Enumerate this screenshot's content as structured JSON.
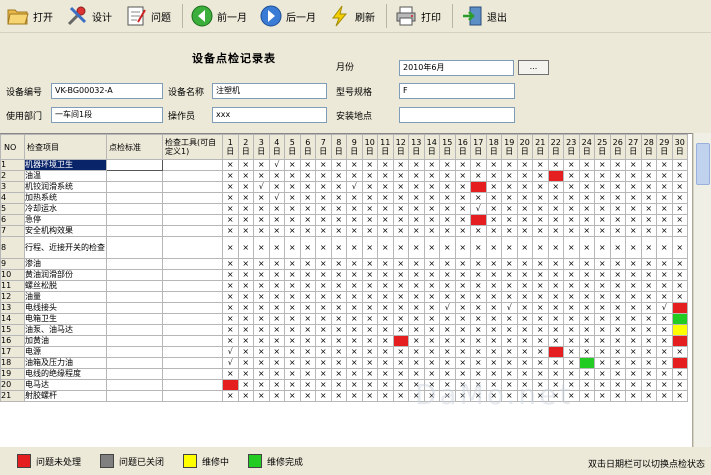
{
  "toolbar": {
    "open": "打开",
    "design": "设计",
    "issue": "问题",
    "prev": "前一月",
    "next": "后一月",
    "refresh": "刷新",
    "print": "打印",
    "exit": "退出"
  },
  "form": {
    "title": "设备点检记录表",
    "month_label": "月份",
    "month_value": "2010年6月",
    "month_button": "...",
    "device_no_label": "设备编号",
    "device_no_value": "VK-BG00032-A",
    "device_name_label": "设备名称",
    "device_name_value": "注塑机",
    "model_label": "型号规格",
    "model_value": "F",
    "dept_label": "使用部门",
    "dept_value": "一车间1段",
    "operator_label": "操作员",
    "operator_value": "xxx",
    "location_label": "安装地点",
    "location_value": ""
  },
  "grid": {
    "col_no": "NO",
    "col_item": "检查项目",
    "col_standard": "点检标准",
    "col_tool": "检查工具(可自定义1)",
    "days": [
      "1",
      "2",
      "3",
      "4",
      "5",
      "6",
      "7",
      "8",
      "9",
      "10",
      "11",
      "12",
      "13",
      "14",
      "15",
      "16",
      "17",
      "18",
      "19",
      "20",
      "21",
      "22",
      "23",
      "24",
      "25",
      "26",
      "27",
      "28",
      "29",
      "30"
    ],
    "day_suffix": "日",
    "rows": [
      {
        "no": "1",
        "item": "机器环境卫生",
        "marks": "X X X ✓ X X X X X X X X X X X X X X X X X X X X X X X X X X"
      },
      {
        "no": "2",
        "item": "油温",
        "marks": "X X X X X X X X X X X X X X X X X X X X X R X X X X X X X X"
      },
      {
        "no": "3",
        "item": "机铰润滑系统",
        "marks": "X X ✓ X X X X X ✓ X X X X X X X R X X X X X X X X X X X X X"
      },
      {
        "no": "4",
        "item": "加热系统",
        "marks": "X X X ✓ X X X X X X X X X X X X X X X X X X X X X X X X X X"
      },
      {
        "no": "5",
        "item": "冷却运水",
        "marks": "X X X X X X X X X X X X X X X X ✓ X X X X X X X X X X X X X"
      },
      {
        "no": "6",
        "item": "急停",
        "marks": "X X X X X X X X X X X X X X X X R X X X X X X X X X X X X X"
      },
      {
        "no": "7",
        "item": "安全机构效果",
        "marks": "X X X X X X X X X X X X X X X X X X X X X X X X X X X X X X"
      },
      {
        "no": "8",
        "item": "行程、近接开关的检查",
        "marks": "X X X X X X X X X X X X X X X X X X X X X X X X X X X X X X",
        "tall": true
      },
      {
        "no": "9",
        "item": "渗油",
        "marks": "X X X X X X X X X X X X X X X X X X X X X X X X X X X X X X"
      },
      {
        "no": "10",
        "item": "黄油润滑部份",
        "marks": "X X X X X X X X X X X X X X X X X X X X X X X X X X X X X X"
      },
      {
        "no": "11",
        "item": "螺丝松脱",
        "marks": "X X X X X X X X X X X X X X X X X X X X X X X X X X X X X X"
      },
      {
        "no": "12",
        "item": "油量",
        "marks": "X X X X X X X X X X X X X X X X X X X X X X X X X X X X X X"
      },
      {
        "no": "13",
        "item": "电线接头",
        "marks": "X X X X X X X X X X X X X X ✓ X X X ✓ X X X X X X X X X ✓ R"
      },
      {
        "no": "14",
        "item": "电箱卫生",
        "marks": "X X X X X X X X X X X X X X X X X X X X X X X X X X X X X G"
      },
      {
        "no": "15",
        "item": "油泵、油马达",
        "marks": "X X X X X X X X X X X X X X X X X X X X X X X X X X X X X Y"
      },
      {
        "no": "16",
        "item": "加黄油",
        "marks": "X X X X X X X X X X X R X X X X X X X X X X X X X X X X X R"
      },
      {
        "no": "17",
        "item": "电源",
        "marks": "✓ X X X X X X X X X X X X X X X X X X X X R X X X X X X X X"
      },
      {
        "no": "18",
        "item": "油箱及压力油",
        "marks": "✓ X X X X X X X X X X X X X X X X X X X X X X G X X X X X R"
      },
      {
        "no": "19",
        "item": "电线的绝缘程度",
        "marks": "X X X X X X X X X X X X X X X X X X X X X X X X X X X X X X"
      },
      {
        "no": "20",
        "item": "电马达",
        "marks": "R X X X X X X X X X X X X X X X X X X X X X X X X X X X X X"
      },
      {
        "no": "21",
        "item": "射胶螺杆",
        "marks": "X X X X X X X X X X X X X X X X X X X X X X X X X X X X X X"
      }
    ],
    "selected_row": 0
  },
  "watermark": "DaMo.net",
  "legend": [
    {
      "label": "问题未处理",
      "color": "#e51f1f"
    },
    {
      "label": "问题已关闭",
      "color": "#808080"
    },
    {
      "label": "维修中",
      "color": "#ffff00"
    },
    {
      "label": "维修完成",
      "color": "#22cc22"
    }
  ],
  "hint": "双击日期栏可以切换点检状态"
}
